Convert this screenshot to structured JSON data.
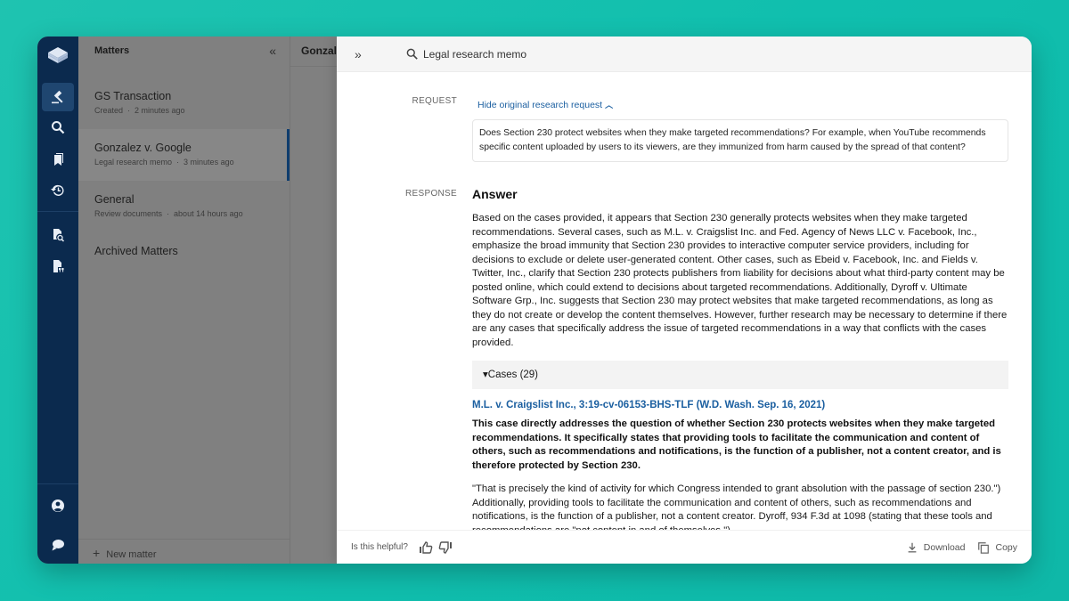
{
  "colors": {
    "background": "#10bfae",
    "rail": "#0b2a4e",
    "rail_active": "#1f4670",
    "link": "#1b5fa0",
    "selected_indicator": "#0f3d6e"
  },
  "rail": {
    "logo": "layers-logo-icon",
    "items": [
      {
        "icon": "gavel-icon",
        "active": true
      },
      {
        "icon": "search-icon",
        "active": false
      },
      {
        "icon": "bookmarks-icon",
        "active": false
      },
      {
        "icon": "history-icon",
        "active": false
      },
      {
        "icon": "document-search-icon",
        "active": false
      },
      {
        "icon": "document-quote-icon",
        "active": false
      }
    ],
    "bottom_items": [
      {
        "icon": "user-account-icon"
      },
      {
        "icon": "chat-bubble-icon"
      }
    ]
  },
  "matters": {
    "title": "Matters",
    "collapse_label": "«",
    "items": [
      {
        "name": "GS Transaction",
        "type": "Created",
        "time": "2 minutes ago",
        "selected": false
      },
      {
        "name": "Gonzalez v. Google",
        "type": "Legal research memo",
        "time": "3 minutes ago",
        "selected": true
      },
      {
        "name": "General",
        "type": "Review documents",
        "time": "about 14 hours ago",
        "selected": false
      }
    ],
    "archived_label": "Archived Matters",
    "new_matter_label": "New matter",
    "dot": "·"
  },
  "middle": {
    "title": "Gonzalez v. Google"
  },
  "panel": {
    "expand_label": "»",
    "search_title": "Legal research memo",
    "request_label": "REQUEST",
    "hide_request_label": "Hide original research request",
    "request_text": "Does Section 230 protect websites when they make targeted recommendations? For example, when YouTube recommends specific content uploaded by users to its viewers, are they immunized from harm caused by the spread of that content?",
    "response_label": "RESPONSE",
    "answer_title": "Answer",
    "answer_text": "Based on the cases provided, it appears that Section 230 generally protects websites when they make targeted recommendations. Several cases, such as M.L. v. Craigslist Inc. and Fed. Agency of News LLC v. Facebook, Inc., emphasize the broad immunity that Section 230 provides to interactive computer service providers, including for decisions to exclude or delete user-generated content. Other cases, such as Ebeid v. Facebook, Inc. and Fields v. Twitter, Inc., clarify that Section 230 protects publishers from liability for decisions about what third-party content may be posted online, which could extend to decisions about targeted recommendations. Additionally, Dyroff v. Ultimate Software Grp., Inc. suggests that Section 230 may protect websites that make targeted recommendations, as long as they do not create or develop the content themselves. However, further research may be necessary to determine if there are any cases that specifically address the issue of targeted recommendations in a way that conflicts with the cases provided.",
    "cases_label": "▾Cases (29)",
    "cases": [
      {
        "title": "M.L. v. Craigslist Inc., 3:19-cv-06153-BHS-TLF (W.D. Wash. Sep. 16, 2021)",
        "summary": "This case directly addresses the question of whether Section 230 protects websites when they make targeted recommendations. It specifically states that providing tools to facilitate the communication and content of others, such as recommendations and notifications, is the function of a publisher, not a content creator, and is therefore protected by Section 230.",
        "quote": "\"That is precisely the kind of activity for which Congress intended to grant absolution with the passage of section 230.\") Additionally, providing tools to facilitate the communication and content of others, such as recommendations and notifications, is the function of a publisher, not a content creator. Dyroff, 934 F.3d at 1098 (stating that these tools and recommendations are \"not content in and of themselves.\")."
      }
    ],
    "footer": {
      "helpful_label": "Is this helpful?",
      "download_label": "Download",
      "copy_label": "Copy"
    }
  }
}
